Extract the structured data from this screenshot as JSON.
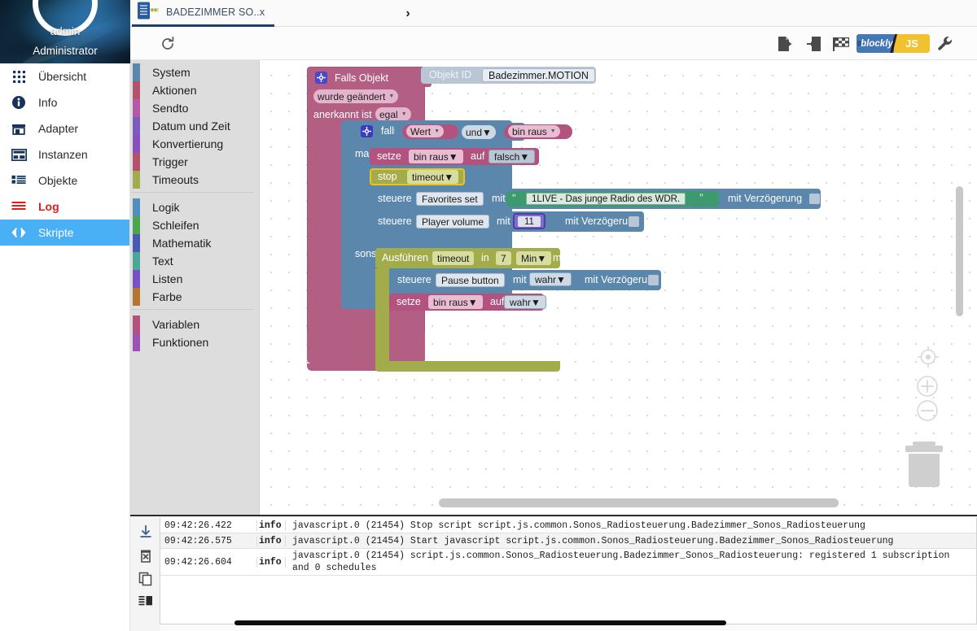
{
  "profile": {
    "name": "admin",
    "role": "Administrator",
    "avatar_icon": "avatar-circle"
  },
  "sidebar": {
    "items": [
      {
        "label": "Übersicht",
        "icon": "grid-icon",
        "active": false
      },
      {
        "label": "Info",
        "icon": "info-circle-icon",
        "active": false
      },
      {
        "label": "Adapter",
        "icon": "store-icon",
        "active": false
      },
      {
        "label": "Instanzen",
        "icon": "instances-icon",
        "active": false
      },
      {
        "label": "Objekte",
        "icon": "list-icon",
        "active": false
      },
      {
        "label": "Log",
        "icon": "log-lines-icon",
        "active": false
      },
      {
        "label": "Skripte",
        "icon": "code-brackets-icon",
        "active": true
      }
    ],
    "active_accent": "#4ab0f5",
    "log_color": "#e21b1b"
  },
  "tabs": {
    "items": [
      {
        "label": "BADEZIMMER SO..x",
        "icon": "script-file-icon",
        "active": true
      }
    ],
    "next_icon": "chevron-right-icon",
    "active_underline": "#1a3f73"
  },
  "toolbar": {
    "refresh_icon": "refresh-icon",
    "export_icon": "export-icon",
    "import_icon": "import-icon",
    "flag_icon": "checkered-flag-icon",
    "wrench_icon": "wrench-icon",
    "toggle": {
      "left_label": "blockly",
      "right_label": "JS",
      "left_color": "#4577b5",
      "right_color": "#f2c12e"
    }
  },
  "toolbox": {
    "groups": [
      {
        "items": [
          {
            "label": "System",
            "color": "#5b87ad"
          },
          {
            "label": "Aktionen",
            "color": "#b4516f"
          },
          {
            "label": "Sendto",
            "color": "#b558a8"
          },
          {
            "label": "Datum und Zeit",
            "color": "#7b5bc0"
          },
          {
            "label": "Konvertierung",
            "color": "#8a4fbe"
          },
          {
            "label": "Trigger",
            "color": "#b4526e"
          },
          {
            "label": "Timeouts",
            "color": "#a3ac4b"
          }
        ]
      },
      {
        "items": [
          {
            "label": "Logik",
            "color": "#4f8fc0"
          },
          {
            "label": "Schleifen",
            "color": "#4ca44c"
          },
          {
            "label": "Mathematik",
            "color": "#4a5ab4"
          },
          {
            "label": "Text",
            "color": "#4aa896"
          },
          {
            "label": "Listen",
            "color": "#7a51c4"
          },
          {
            "label": "Farbe",
            "color": "#b5742f"
          }
        ]
      },
      {
        "items": [
          {
            "label": "Variablen",
            "color": "#b4527f"
          },
          {
            "label": "Funktionen",
            "color": "#9b52b4"
          }
        ]
      }
    ]
  },
  "workspace": {
    "trigger_block": {
      "title": "Falls Objekt",
      "gear_icon": "gear-icon",
      "change_field": "wurde geändert",
      "ack_label": "anerkannt ist",
      "ack_field": "egal",
      "color": "#b35f84"
    },
    "object_id_block": {
      "label": "Objekt ID",
      "value": "Badezimmer.MOTION",
      "color": "#b9c6d6"
    },
    "if_block": {
      "gear_icon": "gear-icon",
      "if_label": "falls",
      "do_label": "mache",
      "else_label": "sonst",
      "color": "#5b87ad"
    },
    "condition": {
      "left_field": "Wert",
      "operator": "und",
      "right_field": "bin raus"
    },
    "set_false": {
      "verb": "setze",
      "variable": "bin raus",
      "mid": "auf",
      "value": "falsch"
    },
    "stop_timeout": {
      "verb": "stop",
      "name": "timeout",
      "color": "#a3ac4b"
    },
    "favorites": {
      "verb": "steuere",
      "target": "Favorites set",
      "mid": "mit",
      "quote_open": "“",
      "quote_close": "”",
      "string_value": "1LIVE - Das junge Radio des WDR.",
      "delay_label": "mit Verzögerung",
      "string_color": "#3d9a6e"
    },
    "volume": {
      "verb": "steuere",
      "target": "Player volume",
      "mid": "mit",
      "number_value": "11",
      "delay_label": "mit Verzögerung",
      "number_color": "#7a6fc9"
    },
    "execute_timeout": {
      "verb": "Ausführen",
      "name": "timeout",
      "in_label": "in",
      "amount": "7",
      "unit": "Min",
      "unit_suffix": "ms",
      "color": "#a3ac4b"
    },
    "pause": {
      "verb": "steuere",
      "target": "Pause button",
      "mid": "mit",
      "value": "wahr",
      "delay_label": "mit Verzögerung"
    },
    "set_true": {
      "verb": "setze",
      "variable": "bin raus",
      "mid": "auf",
      "value": "wahr"
    },
    "controls": {
      "center_icon": "center-target-icon",
      "zoom_in_icon": "zoom-in-icon",
      "zoom_out_icon": "zoom-out-icon",
      "trash_icon": "trash-icon"
    }
  },
  "log": {
    "tools": [
      {
        "icon": "download-icon"
      },
      {
        "icon": "delete-icon"
      },
      {
        "icon": "copy-icon"
      },
      {
        "icon": "list-view-icon"
      }
    ],
    "rows": [
      {
        "timestamp": "09:42:26.422",
        "severity": "info",
        "message": "javascript.0 (21454) Stop script script.js.common.Sonos_Radiosteuerung.Badezimmer_Sonos_Radiosteuerung"
      },
      {
        "timestamp": "09:42:26.575",
        "severity": "info",
        "message": "javascript.0 (21454) Start javascript script.js.common.Sonos_Radiosteuerung.Badezimmer_Sonos_Radiosteuerung"
      },
      {
        "timestamp": "09:42:26.604",
        "severity": "info",
        "message": "javascript.0 (21454) script.js.common.Sonos_Radiosteuerung.Badezimmer_Sonos_Radiosteuerung: registered 1 subscription and 0 schedules"
      }
    ]
  }
}
